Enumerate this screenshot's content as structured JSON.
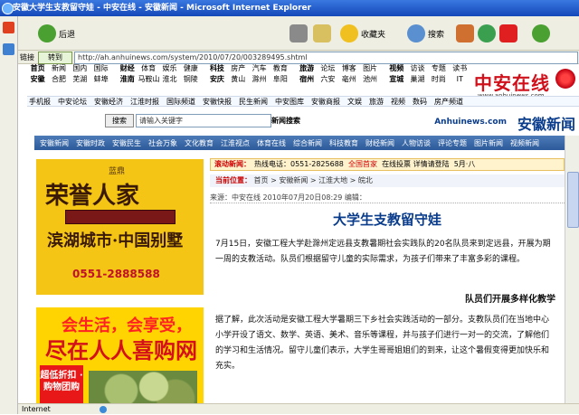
{
  "window": {
    "title": "安徽大学生支教留守娃 - 中安在线 - 安徽新闻 - Microsoft Internet Explorer"
  },
  "toolbar": {
    "back_label": "后退",
    "search_label": "搜索",
    "favorites_label": "收藏夹"
  },
  "address": {
    "label": "地址",
    "go_label": "转到",
    "links_label": "链接",
    "url": "http://ah.anhuinews.com/system/2010/07/20/003289495.shtml"
  },
  "site": {
    "logo_text": "中安在线",
    "logo_url": "www.anhuinews.com",
    "brand_title": "安徽新闻",
    "brand_url": "Anhuinews.com",
    "search_label": "新闻搜索",
    "search_placeholder": "请输入关键字",
    "search_button": "搜索"
  },
  "channels": [
    [
      "首页",
      "新闻",
      "国内",
      "国际",
      "财经",
      "体育",
      "娱乐",
      "健康",
      "科技",
      "房产",
      "汽车",
      "教育",
      "旅游",
      "论坛",
      "博客",
      "图片",
      "视频",
      "访谈",
      "专题",
      "读书"
    ],
    [
      "安徽",
      "合肥",
      "芜湖",
      "蚌埠",
      "淮南",
      "马鞍山",
      "淮北",
      "铜陵",
      "安庆",
      "黄山",
      "滁州",
      "阜阳",
      "宿州",
      "六安",
      "亳州",
      "池州",
      "宣城",
      "巢湖",
      "时尚",
      "IT"
    ]
  ],
  "subnav": [
    "手机报",
    "中安论坛",
    "安徽经济",
    "江淮时报",
    "国际频道",
    "安徽快报",
    "民生新闻",
    "中安图库",
    "安徽商报",
    "文娱",
    "旅游",
    "视频",
    "数码",
    "房产频道"
  ],
  "mainnav": [
    "安徽新闻",
    "安徽时政",
    "安徽民生",
    "社会万象",
    "文化教育",
    "江淮视点",
    "体育在线",
    "综合新闻",
    "科技教育",
    "财经新闻",
    "人物访谈",
    "评论专题",
    "图片新闻",
    "视频新闻"
  ],
  "ads": {
    "ad1": {
      "top": "蓝鼎",
      "big": "荣誉人家",
      "mid": "滨湖城市·中国别墅",
      "phone": "0551-2888588"
    },
    "ad2": {
      "t1": "会生活，会享受，",
      "t2": "尽在人人喜购网",
      "badge": "超低折扣 · 购物团购"
    }
  },
  "article": {
    "banner_label": "滚动新闻：",
    "banner_items": [
      "热线电话：0551-2825688",
      "全国首家",
      "在线投票 详情请登陆",
      "5月·八"
    ],
    "breadcrumb_prefix": "当前位置：",
    "breadcrumb": "首页 > 安徽新闻 > 江淮大地 > 皖北",
    "breadcrumb_current": "安徽新闻",
    "meta": "来源：中安在线    2010年07月20日08:29    编辑：",
    "headline": "大学生支教留守娃",
    "para1": "7月15日，安徽工程大学赴滁州定远县支教暑期社会实践队的20名队员来到定远县，开展为期一周的支教活动。队员们根据留守儿童的实际需求，为孩子们带来了丰富多彩的课程。",
    "subheading": "队员们开展多样化教学",
    "para2": "据了解，此次活动是安徽工程大学暑期三下乡社会实践活动的一部分。支教队员们在当地中心小学开设了语文、数学、英语、美术、音乐等课程，并与孩子们进行一对一的交流，了解他们的学习和生活情况。留守儿童们表示，大学生哥哥姐姐们的到来，让这个暑假变得更加快乐和充实。"
  },
  "status": {
    "zone": "Internet"
  }
}
